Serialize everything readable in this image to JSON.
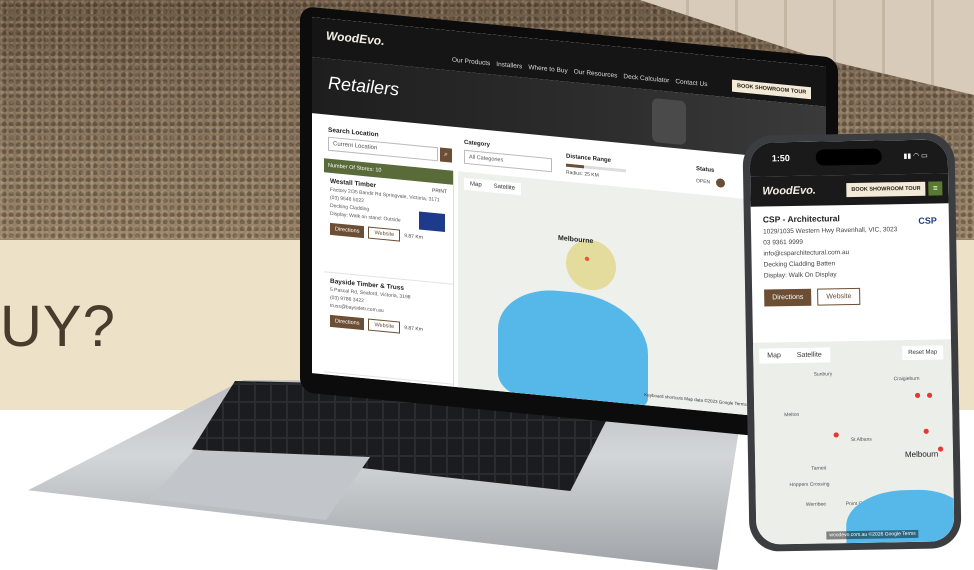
{
  "headline": "UY?",
  "laptop": {
    "logo": "WoodEvo.",
    "nav": [
      "Our Products",
      "Installers",
      "Where to Buy",
      "Our Resources",
      "Deck Calculator",
      "Contact Us"
    ],
    "tour_button": "BOOK SHOWROOM TOUR",
    "page_title": "Retailers",
    "search": {
      "label": "Search Location",
      "placeholder": "Current Location",
      "clear": "×"
    },
    "category": {
      "label": "Category",
      "value": "All Categories"
    },
    "distance": {
      "label": "Distance Range",
      "value": "Radius: 25 KM",
      "fraction": 0.3
    },
    "status": {
      "label": "Status",
      "value": "OPEN"
    },
    "results_count": "Number Of Stores: 10",
    "stores": [
      {
        "name": "Westall Timber",
        "print": "PRINT",
        "address": "Factory 2/35 Bandir Rd Springvale, Victoria, 3171",
        "phone": "(03) 9546 5022",
        "tags": "Decking  Cladding",
        "display": "Display: Walk on stand: Outside",
        "directions": "Directions",
        "website": "Website",
        "distance": "9.87 Km"
      },
      {
        "name": "Bayside Timber & Truss",
        "address": "5 Pascal Rd, Seaford, Victoria, 3198",
        "phone": "(03) 9786 3422",
        "email": "truss@baysidetr.com.au",
        "directions": "Directions",
        "website": "Website",
        "distance": "9.87 Km"
      }
    ],
    "map": {
      "tabs": [
        "Map",
        "Satellite"
      ],
      "city": "Melbourne",
      "footer": "Keyboard shortcuts  Map data ©2023 Google  Terms  Report a map error"
    }
  },
  "phone": {
    "time": "1:50",
    "logo": "WoodEvo.",
    "tour_button": "BOOK SHOWROOM TOUR",
    "store": {
      "name": "CSP - Architectural",
      "address": "1029/1035 Western Hwy Ravenhall, VIC, 3023",
      "phone": "03 9361 9999",
      "email": "info@csparchitectural.com.au",
      "tags": "Decking  Cladding  Batten",
      "display": "Display: Walk On Display",
      "logo_text": "CSP",
      "directions": "Directions",
      "website": "Website"
    },
    "map": {
      "tabs": [
        "Map",
        "Satellite"
      ],
      "reset": "Reset Map",
      "city": "Melbourn",
      "places": [
        "Sunbury",
        "Craigieburn",
        "Melton",
        "St Albans",
        "Tarneit",
        "Hoppers Crossing",
        "Werribee",
        "Point Cook"
      ],
      "footer": "woodevo.com.au  ©2026 Google  Terms"
    }
  }
}
